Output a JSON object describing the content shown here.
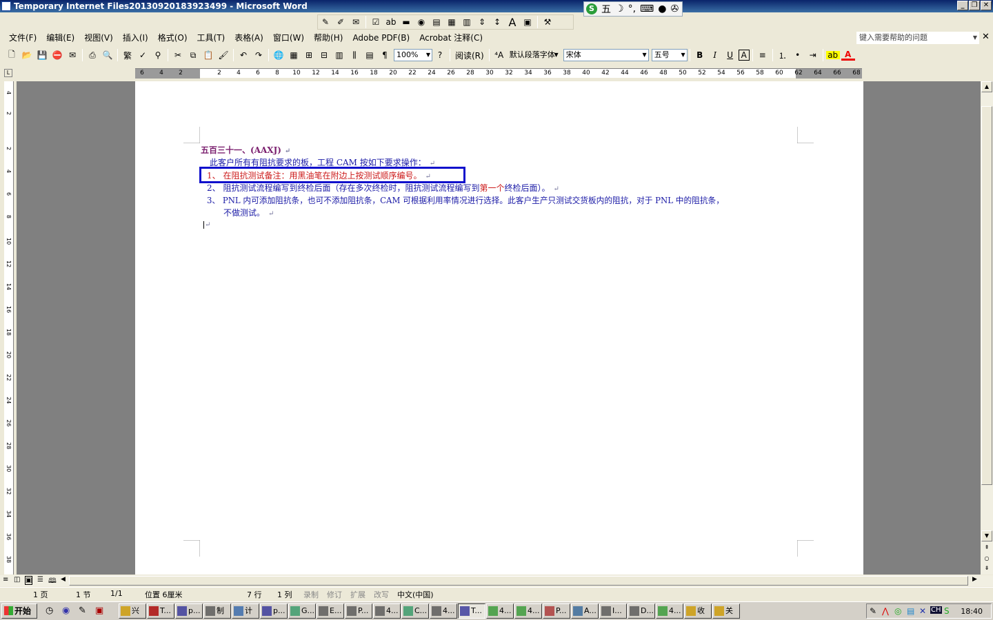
{
  "window": {
    "title": "Temporary Internet Files20130920183923499 - Microsoft Word"
  },
  "ime": {
    "label": "五"
  },
  "menu": {
    "items": [
      "文件(F)",
      "编辑(E)",
      "视图(V)",
      "插入(I)",
      "格式(O)",
      "工具(T)",
      "表格(A)",
      "窗口(W)",
      "帮助(H)",
      "Adobe PDF(B)",
      "Acrobat 注释(C)"
    ]
  },
  "help": {
    "placeholder": "键入需要帮助的问题"
  },
  "standard_toolbar": {
    "zoom": "100%",
    "read_label": "阅读(R)"
  },
  "format_toolbar": {
    "style": "默认段落字体",
    "font": "宋体",
    "size": "五号",
    "bold": "B",
    "italic": "I",
    "underline": "U",
    "char_border": "A"
  },
  "ruler": {
    "top_labels": [
      "6",
      "4",
      "2",
      "2",
      "4",
      "6",
      "8",
      "10",
      "12",
      "14",
      "16",
      "18",
      "20",
      "22",
      "24",
      "26",
      "28",
      "30",
      "32",
      "34",
      "36",
      "38",
      "40",
      "42",
      "44",
      "46",
      "48",
      "50",
      "52",
      "54",
      "56",
      "58",
      "60",
      "62",
      "64",
      "66",
      "68"
    ],
    "left_labels": [
      "4",
      "2",
      "2",
      "4",
      "6",
      "8",
      "10",
      "12",
      "14",
      "16",
      "18",
      "20",
      "22",
      "24",
      "26",
      "28",
      "30",
      "32",
      "34",
      "36",
      "38"
    ]
  },
  "document": {
    "heading": "五百三十一、(AAXJ)",
    "intro": "此客户所有有阻抗要求的板，工程 CAM 按如下要求操作：",
    "item1": "1、 在阻抗测试备注：用黑油笔在附边上按测试顺序编号。",
    "item2_a": "2、 阻抗测试流程编写到终检后面（存在多次终检时，阻抗测试流程编写到",
    "item2_b": "第一个",
    "item2_c": "终检后面）。",
    "item3_a": "3、 PNL 内可添加阻抗条，也可不添加阻抗条，CAM 可根据利用率情况进行选择。此客户生产只测试交货板内的阻抗，对于 PNL 中的阻抗条，",
    "item3_b": "不做测试。",
    "para_mark": "↵",
    "heading_color": "#7a1e6e",
    "text_color": "#1a1aa6",
    "red_color": "#cc1a1a",
    "highlight_color": "#1010cc"
  },
  "status": {
    "page": "1 页",
    "section": "1 节",
    "pages": "1/1",
    "position": "位置 6厘米",
    "line": "7 行",
    "col": "1 列",
    "rec": "录制",
    "trk": "修订",
    "ext": "扩展",
    "ovr": "改写",
    "lang": "中文(中国)"
  },
  "taskbar": {
    "start": "开始",
    "tasks": [
      "兴",
      "T...",
      "p...",
      "制",
      "计",
      "p...",
      "G...",
      "E...",
      "P...",
      "4...",
      "C...",
      "4...",
      "T...",
      "4...",
      "4...",
      "P...",
      "A...",
      "I...",
      "D...",
      "4...",
      "收",
      "关"
    ],
    "tray_lang": "CH",
    "clock": "18:40"
  }
}
